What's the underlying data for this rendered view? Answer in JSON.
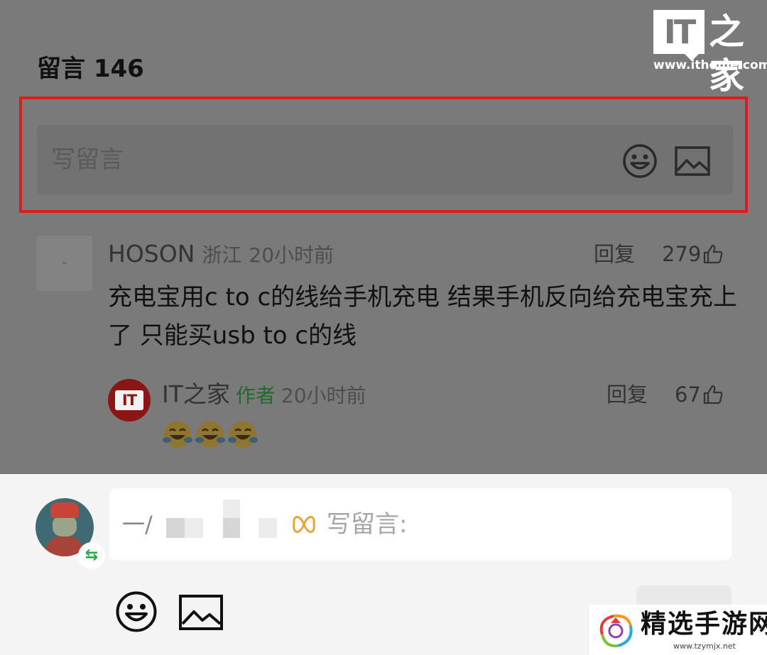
{
  "watermark_top": {
    "logo_text": "IT",
    "logo_char": "之家",
    "url": "www.ithome.com"
  },
  "comments_header": "留言 146",
  "compose_bar": {
    "placeholder": "写留言",
    "emoji_icon": "smiley-icon",
    "image_icon": "image-icon"
  },
  "comment": {
    "user": "HOSON",
    "region": "浙江",
    "time": "20小时前",
    "reply_label": "回复",
    "likes": "279",
    "text": "充电宝用c to c的线给手机充电 结果手机反向给充电宝充上了 只能买usb to c的线"
  },
  "reply": {
    "avatar_text": "IT",
    "user": "IT之家",
    "author_badge": "作者",
    "time": "20小时前",
    "reply_label": "回复",
    "likes": "67",
    "emoji_icon": "laughing-crying-emoji"
  },
  "input_panel": {
    "prefix": "一/",
    "placeholder": "写留言:",
    "switch_glyph": "⇆",
    "emoji_icon": "smiley-icon",
    "image_icon": "image-icon"
  },
  "watermark_bottom": {
    "name": "精选手游网",
    "url": "www.tzymjx.net"
  },
  "colors": {
    "highlight": "#d81e1e",
    "author_badge": "#1f6b2c",
    "avatar_red": "#8a1616",
    "switch_green": "#2aa84a"
  }
}
